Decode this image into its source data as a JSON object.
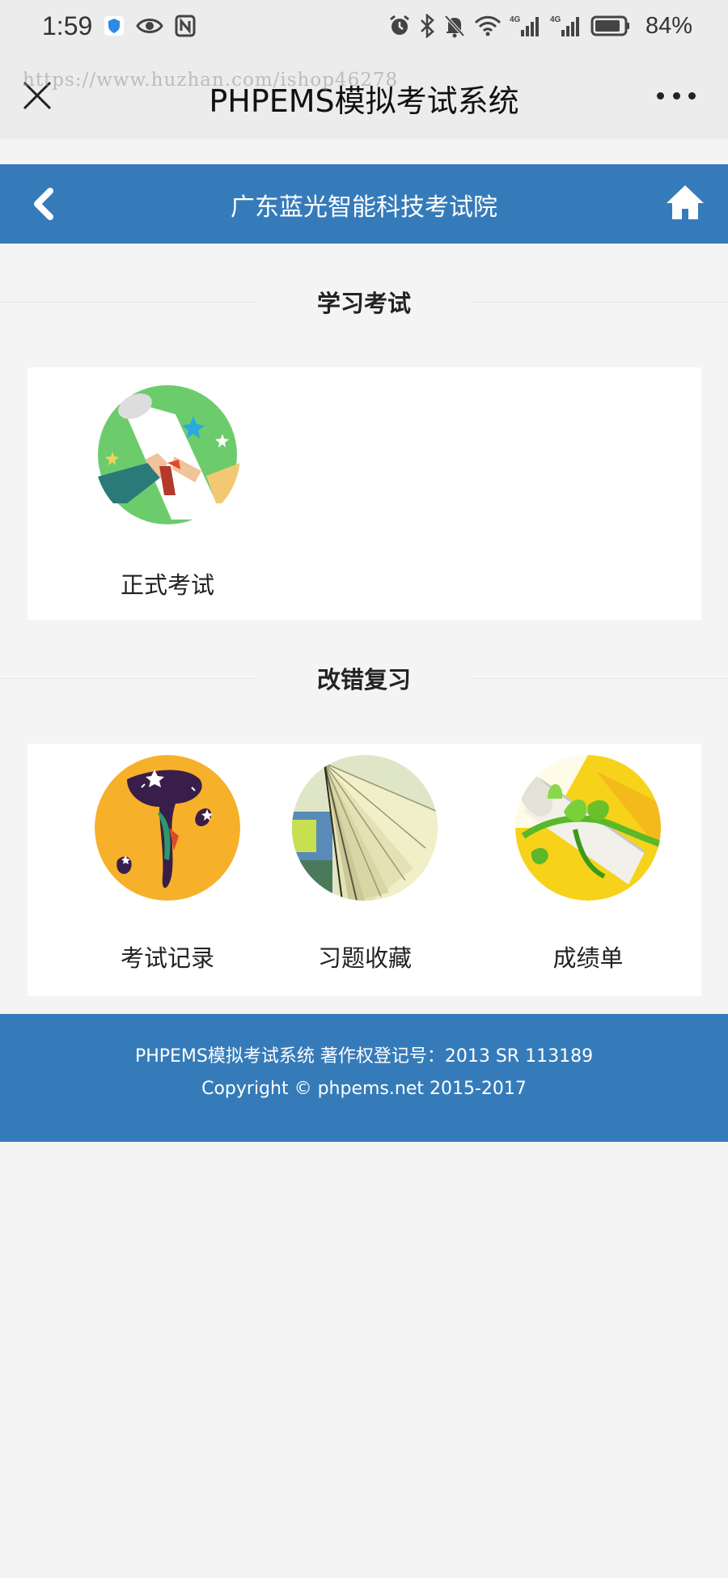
{
  "status_bar": {
    "time": "1:59",
    "battery": "84%",
    "icons": [
      "shield-icon",
      "eye-icon",
      "nfc-icon",
      "alarm-icon",
      "bluetooth-icon",
      "bell-off-icon",
      "wifi-icon",
      "signal-4g-icon",
      "signal-4g-icon",
      "battery-icon"
    ]
  },
  "browser": {
    "title": "PHPEMS模拟考试系统",
    "watermark": "https://www.huzhan.com/ishop46278"
  },
  "app_header": {
    "title": "广东蓝光智能科技考试院",
    "color": "#367bb9"
  },
  "sections": [
    {
      "title": "学习考试",
      "tiles": [
        {
          "label": "正式考试",
          "icon": "diploma-handshake-icon"
        }
      ]
    },
    {
      "title": "改错复习",
      "tiles": [
        {
          "label": "考试记录",
          "icon": "exam-record-icon"
        },
        {
          "label": "习题收藏",
          "icon": "book-pages-icon"
        },
        {
          "label": "成绩单",
          "icon": "diploma-ribbon-icon"
        }
      ]
    }
  ],
  "footer": {
    "line1": "PHPEMS模拟考试系统 著作权登记号：2013 SR 113189",
    "line2": "Copyright © phpems.net 2015-2017"
  }
}
